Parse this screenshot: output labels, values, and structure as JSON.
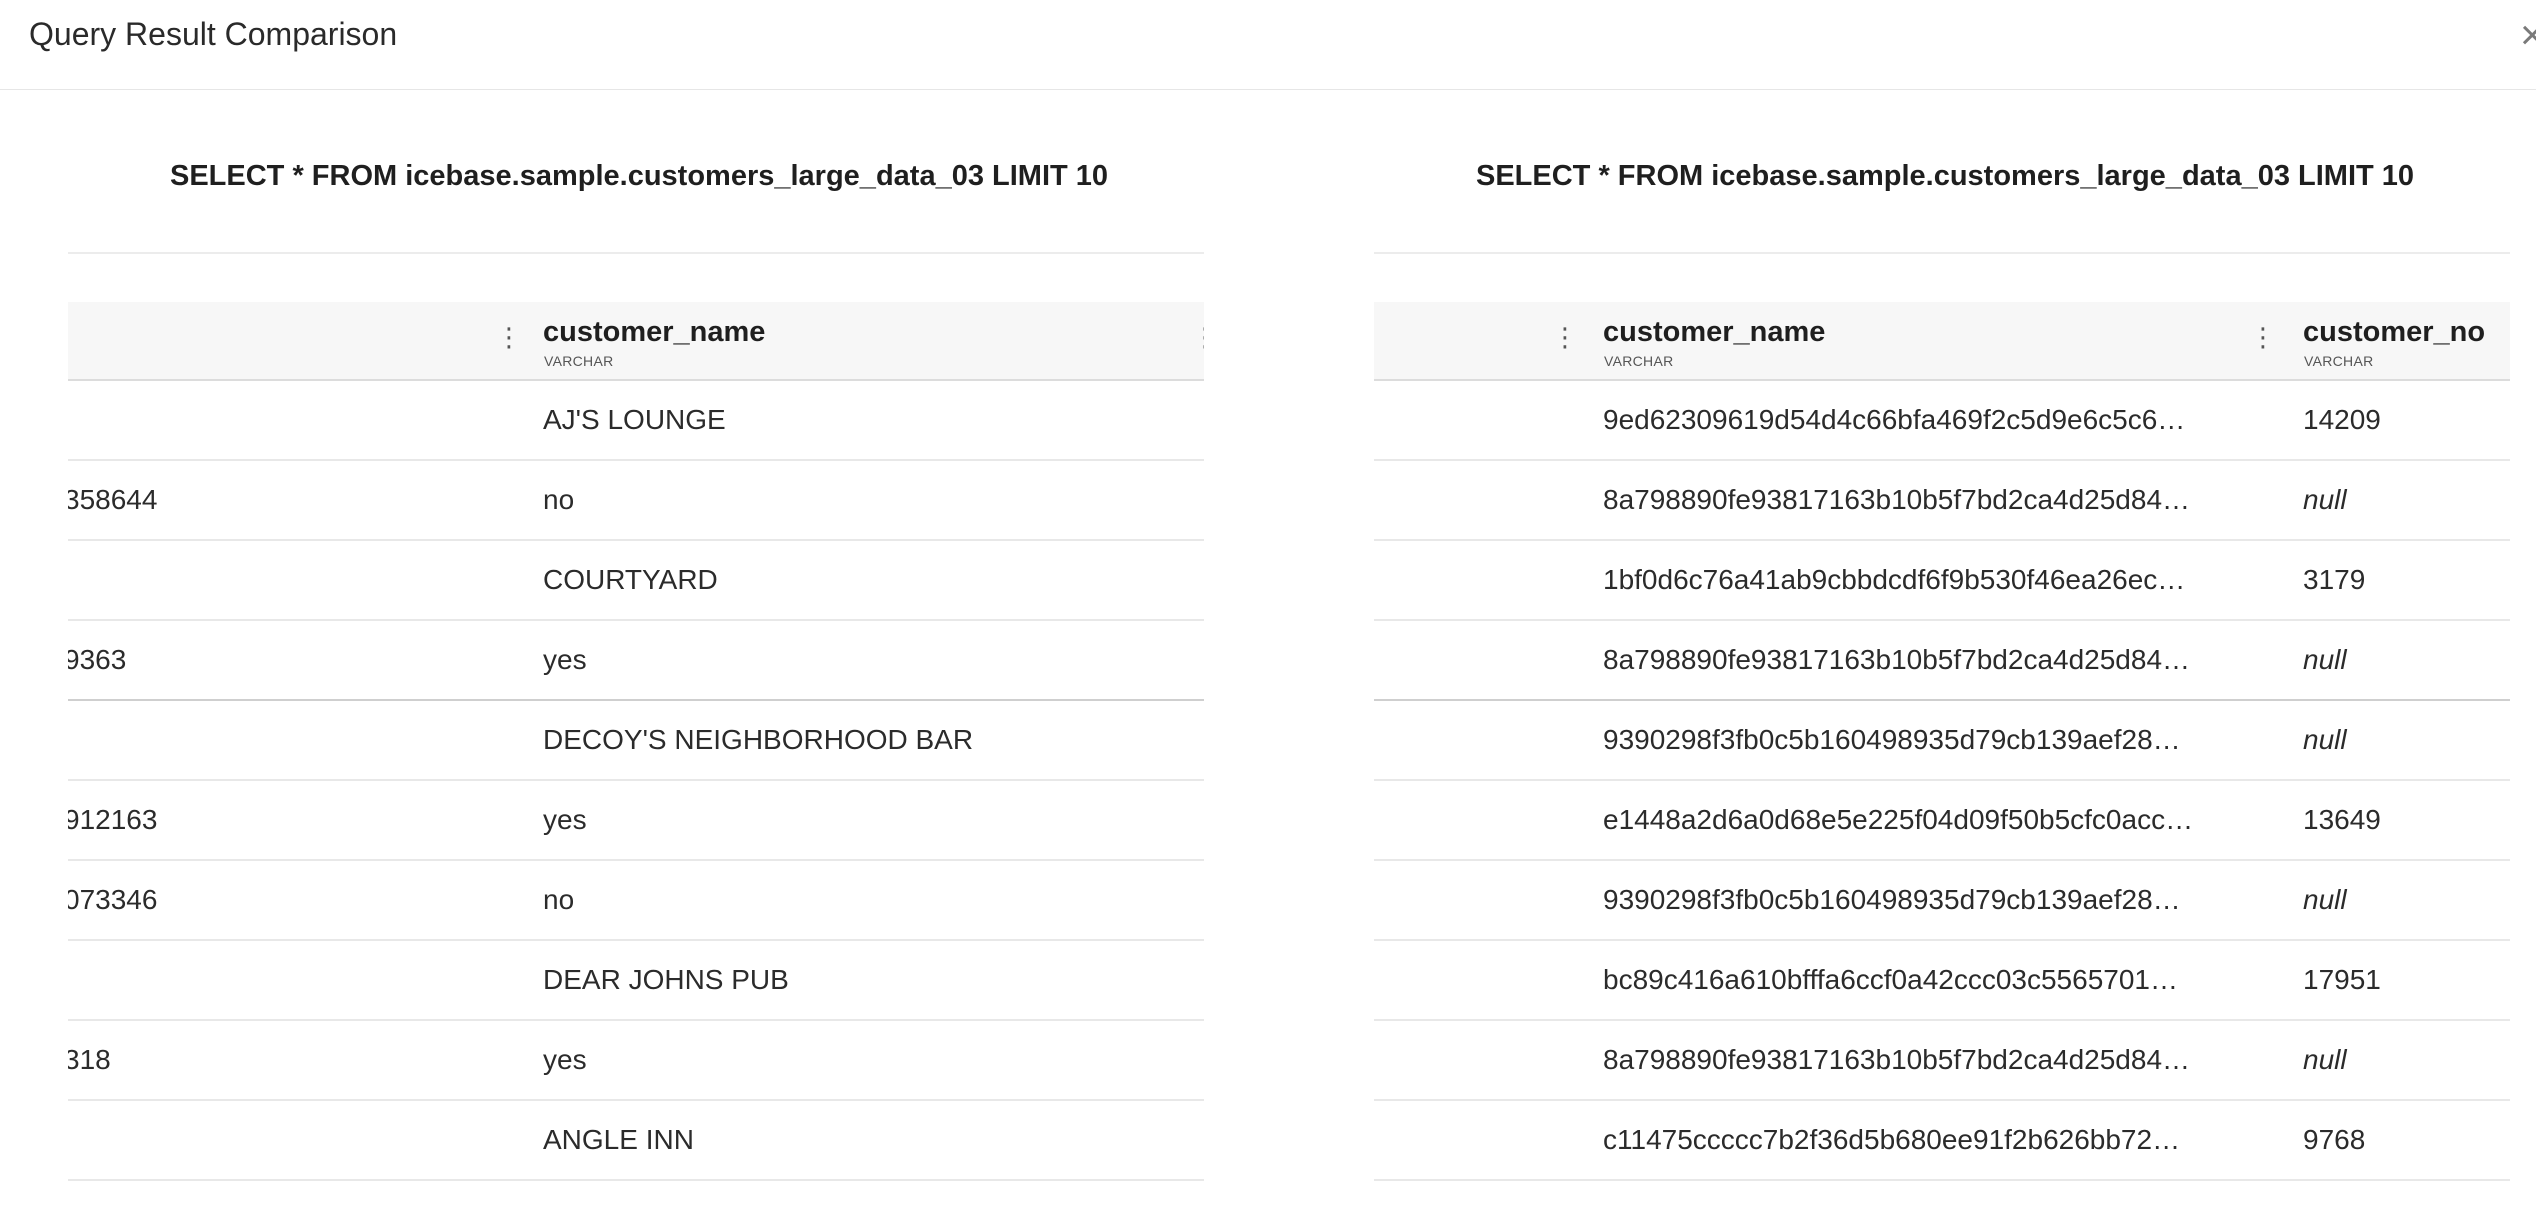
{
  "modal": {
    "title": "Query Result Comparison",
    "close_symbol": "×"
  },
  "left": {
    "query": "SELECT * FROM icebase.sample.customers_large_data_03 LIMIT 10",
    "columns": [
      {
        "name": "",
        "type": ""
      },
      {
        "name": "customer_name",
        "type": "VARCHAR"
      }
    ],
    "rows": [
      {
        "c0": "",
        "c1": "AJ'S LOUNGE"
      },
      {
        "c0": "358644",
        "c1": "no"
      },
      {
        "c0": "",
        "c1": "COURTYARD"
      },
      {
        "c0": "9363",
        "c1": "yes"
      },
      {
        "c0": "",
        "c1": "DECOY'S NEIGHBORHOOD BAR"
      },
      {
        "c0": "912163",
        "c1": "yes"
      },
      {
        "c0": "073346",
        "c1": "no"
      },
      {
        "c0": "",
        "c1": "DEAR JOHNS PUB"
      },
      {
        "c0": "318",
        "c1": "yes"
      },
      {
        "c0": "",
        "c1": "ANGLE INN"
      }
    ]
  },
  "right": {
    "query": "SELECT * FROM icebase.sample.customers_large_data_03 LIMIT 10",
    "columns": [
      {
        "name": "",
        "type": ""
      },
      {
        "name": "customer_name",
        "type": "VARCHAR"
      },
      {
        "name": "customer_no",
        "type": "VARCHAR"
      }
    ],
    "rows": [
      {
        "c1": "9ed62309619d54d4c66bfa469f2c5d9e6c5c6…",
        "c2": "14209"
      },
      {
        "c1": "8a798890fe93817163b10b5f7bd2ca4d25d84…",
        "c2": "null"
      },
      {
        "c1": "1bf0d6c76a41ab9cbbdcdf6f9b530f46ea26ec…",
        "c2": "3179"
      },
      {
        "c1": "8a798890fe93817163b10b5f7bd2ca4d25d84…",
        "c2": "null"
      },
      {
        "c1": "9390298f3fb0c5b160498935d79cb139aef28…",
        "c2": "null"
      },
      {
        "c1": "e1448a2d6a0d68e5e225f04d09f50b5cfc0acc…",
        "c2": "13649"
      },
      {
        "c1": "9390298f3fb0c5b160498935d79cb139aef28…",
        "c2": "null"
      },
      {
        "c1": "bc89c416a610bfffa6ccf0a42ccc03c5565701…",
        "c2": "17951"
      },
      {
        "c1": "8a798890fe93817163b10b5f7bd2ca4d25d84…",
        "c2": "null"
      },
      {
        "c1": "c11475ccccc7b2f36d5b680ee91f2b626bb72…",
        "c2": "9768"
      }
    ]
  }
}
